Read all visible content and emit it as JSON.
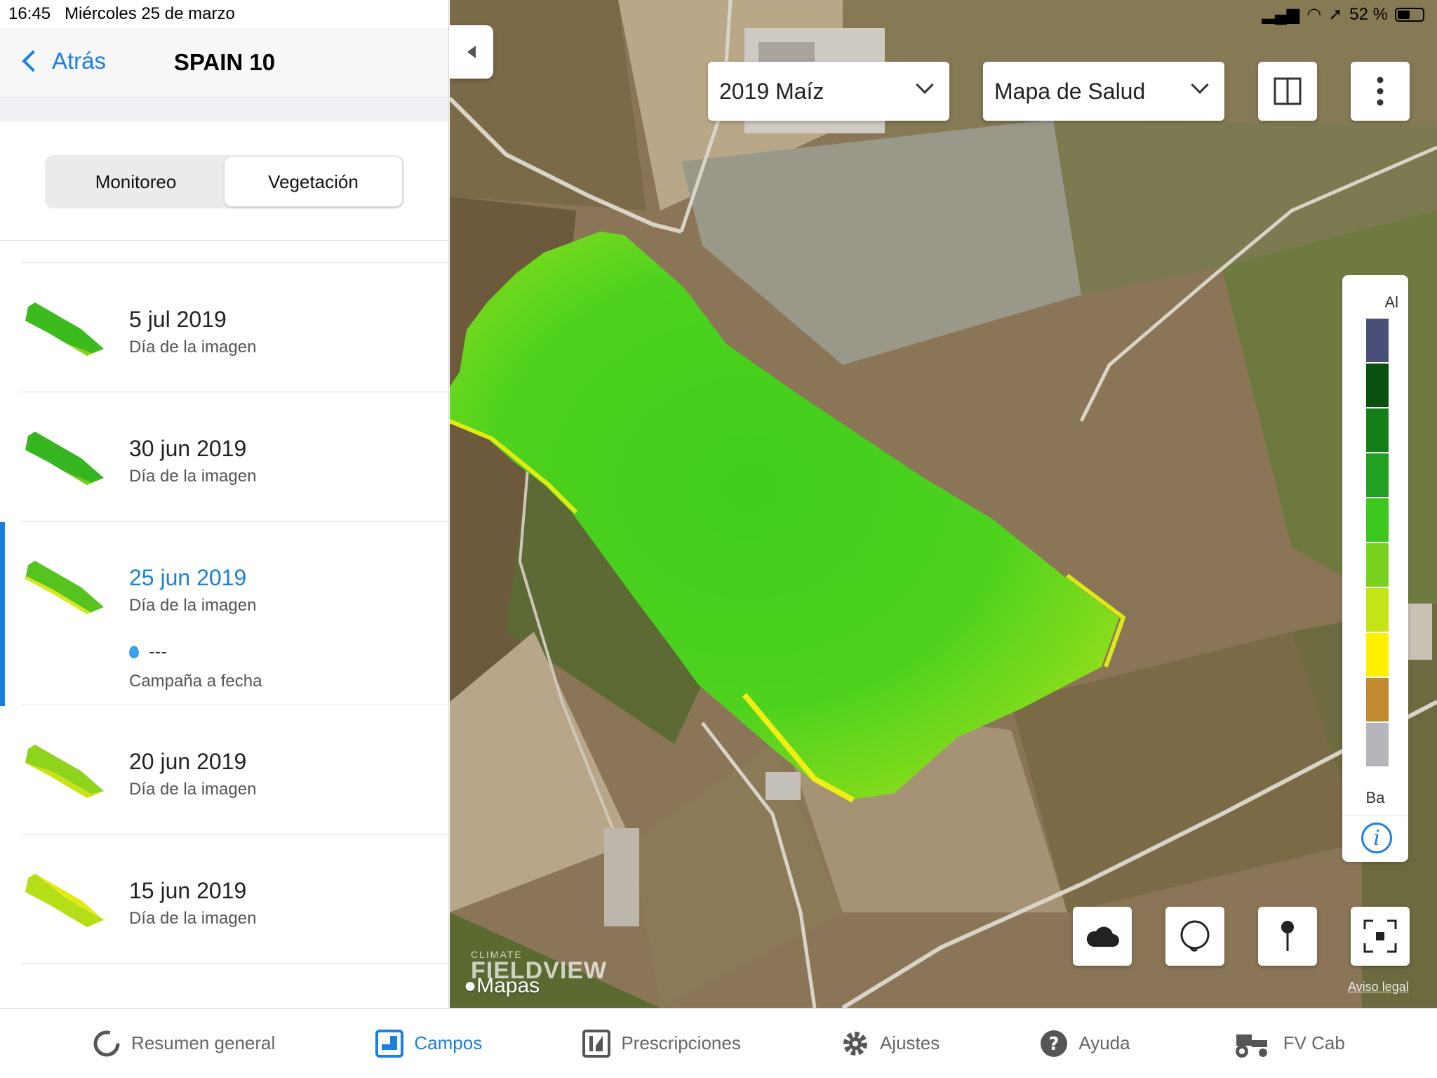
{
  "status": {
    "time": "16:45",
    "date": "Miércoles 25 de marzo",
    "battery": "52 %"
  },
  "nav": {
    "back_label": "Atrás",
    "title": "SPAIN 10"
  },
  "segment": {
    "monitor": "Monitoreo",
    "vegetation": "Vegetación"
  },
  "images": [
    {
      "date": "5 jul 2019",
      "sub": "Día de la imagen"
    },
    {
      "date": "30 jun 2019",
      "sub": "Día de la imagen"
    },
    {
      "date": "25 jun 2019",
      "sub": "Día de la imagen",
      "rain": "---",
      "campaign": "Campaña a fecha"
    },
    {
      "date": "20 jun 2019",
      "sub": "Día de la imagen"
    },
    {
      "date": "15 jun 2019",
      "sub": "Día de la imagen"
    }
  ],
  "map": {
    "season": "2019 Maíz",
    "layer": "Mapa de Salud",
    "legend_high": "Al",
    "legend_low": "Ba",
    "legend_colors": [
      "#4a4f78",
      "#0a5010",
      "#15801a",
      "#22a022",
      "#3cc81e",
      "#78d21e",
      "#c4e416",
      "#fff000",
      "#c28a30",
      "#b4b6bc"
    ],
    "brand_small": "CLIMATE",
    "brand": "FIELDVIEW",
    "maps_label": "Mapas",
    "legal": "Aviso legal"
  },
  "tabs": [
    {
      "label": "Resumen general",
      "icon": "overview-icon"
    },
    {
      "label": "Campos",
      "icon": "fields-icon"
    },
    {
      "label": "Prescripciones",
      "icon": "prescriptions-icon"
    },
    {
      "label": "Ajustes",
      "icon": "gear-icon"
    },
    {
      "label": "Ayuda",
      "icon": "help-icon"
    },
    {
      "label": "FV Cab",
      "icon": "tractor-icon"
    }
  ]
}
